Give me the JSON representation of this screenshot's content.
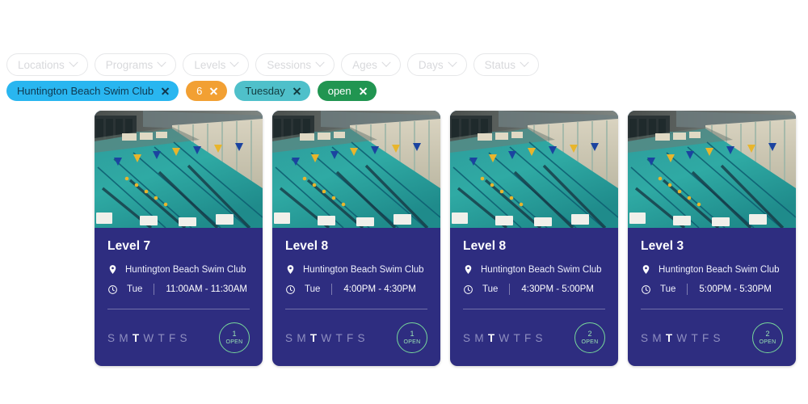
{
  "filters": {
    "pills": [
      {
        "label": "Locations",
        "icon": "chevron-down-icon"
      },
      {
        "label": "Programs",
        "icon": "chevron-down-icon"
      },
      {
        "label": "Levels",
        "icon": "chevron-down-icon"
      },
      {
        "label": "Sessions",
        "icon": "chevron-down-icon"
      },
      {
        "label": "Ages",
        "icon": "chevron-down-icon"
      },
      {
        "label": "Days",
        "icon": "chevron-down-icon"
      },
      {
        "label": "Status",
        "icon": "chevron-down-icon"
      }
    ],
    "chips": [
      {
        "label": "Huntington Beach Swim Club",
        "kind": "location",
        "color": "#29b6f0",
        "remove_icon": "close-icon"
      },
      {
        "label": "6",
        "kind": "age",
        "color": "#f2a033",
        "remove_icon": "close-icon"
      },
      {
        "label": "Tuesday",
        "kind": "day",
        "color": "#4fc0ca",
        "remove_icon": "close-icon"
      },
      {
        "label": "open",
        "kind": "status",
        "color": "#219551",
        "remove_icon": "close-icon"
      }
    ]
  },
  "dow_letters": [
    "S",
    "M",
    "T",
    "W",
    "T",
    "F",
    "S"
  ],
  "cards": [
    {
      "title": "Level 7",
      "location": "Huntington Beach Swim Club",
      "location_icon": "map-pin-icon",
      "time_icon": "clock-icon",
      "day": "Tue",
      "time_range": "11:00AM - 11:30AM",
      "active_day_index": 2,
      "open_count": "1",
      "open_label": "OPEN",
      "photo_alt": "indoor-swimming-pool-photo"
    },
    {
      "title": "Level 8",
      "location": "Huntington Beach Swim Club",
      "location_icon": "map-pin-icon",
      "time_icon": "clock-icon",
      "day": "Tue",
      "time_range": "4:00PM - 4:30PM",
      "active_day_index": 2,
      "open_count": "1",
      "open_label": "OPEN",
      "photo_alt": "indoor-swimming-pool-photo"
    },
    {
      "title": "Level 8",
      "location": "Huntington Beach Swim Club",
      "location_icon": "map-pin-icon",
      "time_icon": "clock-icon",
      "day": "Tue",
      "time_range": "4:30PM - 5:00PM",
      "active_day_index": 2,
      "open_count": "2",
      "open_label": "OPEN",
      "photo_alt": "indoor-swimming-pool-photo"
    },
    {
      "title": "Level 3",
      "location": "Huntington Beach Swim Club",
      "location_icon": "map-pin-icon",
      "time_icon": "clock-icon",
      "day": "Tue",
      "time_range": "5:00PM - 5:30PM",
      "active_day_index": 2,
      "open_count": "2",
      "open_label": "OPEN",
      "photo_alt": "indoor-swimming-pool-photo"
    }
  ],
  "colors": {
    "card_background": "#2e2d80",
    "page_background": "#ffffff",
    "open_accent": "#9ae3b3"
  }
}
